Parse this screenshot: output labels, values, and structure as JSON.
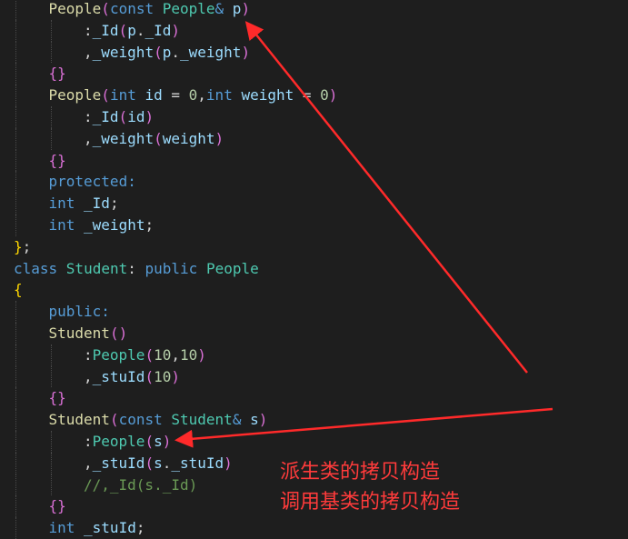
{
  "code_lines": [
    {
      "indent": 1,
      "tokens": [
        {
          "t": "People",
          "c": "fn"
        },
        {
          "t": "(",
          "c": "br1"
        },
        {
          "t": "const ",
          "c": "kw"
        },
        {
          "t": "People",
          "c": "type"
        },
        {
          "t": "& ",
          "c": "kw"
        },
        {
          "t": "p",
          "c": "var"
        },
        {
          "t": ")",
          "c": "br1"
        }
      ]
    },
    {
      "indent": 2,
      "tokens": [
        {
          "t": ":",
          "c": "pl"
        },
        {
          "t": "_Id",
          "c": "var"
        },
        {
          "t": "(",
          "c": "br1"
        },
        {
          "t": "p",
          "c": "var"
        },
        {
          "t": ".",
          "c": "pl"
        },
        {
          "t": "_Id",
          "c": "var"
        },
        {
          "t": ")",
          "c": "br1"
        }
      ]
    },
    {
      "indent": 2,
      "tokens": [
        {
          "t": ",",
          "c": "pl"
        },
        {
          "t": "_weight",
          "c": "var"
        },
        {
          "t": "(",
          "c": "br1"
        },
        {
          "t": "p",
          "c": "var"
        },
        {
          "t": ".",
          "c": "pl"
        },
        {
          "t": "_weight",
          "c": "var"
        },
        {
          "t": ")",
          "c": "br1"
        }
      ]
    },
    {
      "indent": 1,
      "tokens": [
        {
          "t": "{}",
          "c": "br1"
        }
      ]
    },
    {
      "indent": 1,
      "tokens": [
        {
          "t": "People",
          "c": "fn"
        },
        {
          "t": "(",
          "c": "br1"
        },
        {
          "t": "int ",
          "c": "kw"
        },
        {
          "t": "id",
          "c": "var"
        },
        {
          "t": " = ",
          "c": "pl"
        },
        {
          "t": "0",
          "c": "num"
        },
        {
          "t": ",",
          "c": "pl"
        },
        {
          "t": "int ",
          "c": "kw"
        },
        {
          "t": "weight",
          "c": "var"
        },
        {
          "t": " = ",
          "c": "pl"
        },
        {
          "t": "0",
          "c": "num"
        },
        {
          "t": ")",
          "c": "br1"
        }
      ]
    },
    {
      "indent": 2,
      "tokens": [
        {
          "t": ":",
          "c": "pl"
        },
        {
          "t": "_Id",
          "c": "var"
        },
        {
          "t": "(",
          "c": "br1"
        },
        {
          "t": "id",
          "c": "var"
        },
        {
          "t": ")",
          "c": "br1"
        }
      ]
    },
    {
      "indent": 2,
      "tokens": [
        {
          "t": ",",
          "c": "pl"
        },
        {
          "t": "_weight",
          "c": "var"
        },
        {
          "t": "(",
          "c": "br1"
        },
        {
          "t": "weight",
          "c": "var"
        },
        {
          "t": ")",
          "c": "br1"
        }
      ]
    },
    {
      "indent": 1,
      "tokens": [
        {
          "t": "{}",
          "c": "br1"
        }
      ]
    },
    {
      "indent": 1,
      "tokens": [
        {
          "t": "protected:",
          "c": "kw"
        }
      ]
    },
    {
      "indent": 1,
      "tokens": [
        {
          "t": "int ",
          "c": "kw"
        },
        {
          "t": "_Id",
          "c": "var"
        },
        {
          "t": ";",
          "c": "pl"
        }
      ]
    },
    {
      "indent": 1,
      "tokens": [
        {
          "t": "int ",
          "c": "kw"
        },
        {
          "t": "_weight",
          "c": "var"
        },
        {
          "t": ";",
          "c": "pl"
        }
      ]
    },
    {
      "indent": 0,
      "tokens": [
        {
          "t": "}",
          "c": "br2"
        },
        {
          "t": ";",
          "c": "pl"
        }
      ]
    },
    {
      "indent": 0,
      "tokens": [
        {
          "t": "class ",
          "c": "kw"
        },
        {
          "t": "Student",
          "c": "type"
        },
        {
          "t": ": ",
          "c": "pl"
        },
        {
          "t": "public ",
          "c": "kw"
        },
        {
          "t": "People",
          "c": "type"
        }
      ]
    },
    {
      "indent": 0,
      "tokens": [
        {
          "t": "{",
          "c": "br2"
        }
      ]
    },
    {
      "indent": 1,
      "tokens": [
        {
          "t": "public:",
          "c": "kw"
        }
      ]
    },
    {
      "indent": 1,
      "tokens": [
        {
          "t": "Student",
          "c": "fn"
        },
        {
          "t": "()",
          "c": "br1"
        }
      ]
    },
    {
      "indent": 2,
      "tokens": [
        {
          "t": ":",
          "c": "pl"
        },
        {
          "t": "People",
          "c": "type"
        },
        {
          "t": "(",
          "c": "br1"
        },
        {
          "t": "10",
          "c": "num"
        },
        {
          "t": ",",
          "c": "pl"
        },
        {
          "t": "10",
          "c": "num"
        },
        {
          "t": ")",
          "c": "br1"
        }
      ]
    },
    {
      "indent": 2,
      "tokens": [
        {
          "t": ",",
          "c": "pl"
        },
        {
          "t": "_stuId",
          "c": "var"
        },
        {
          "t": "(",
          "c": "br1"
        },
        {
          "t": "10",
          "c": "num"
        },
        {
          "t": ")",
          "c": "br1"
        }
      ]
    },
    {
      "indent": 1,
      "tokens": [
        {
          "t": "{}",
          "c": "br1"
        }
      ]
    },
    {
      "indent": 1,
      "tokens": [
        {
          "t": "Student",
          "c": "fn"
        },
        {
          "t": "(",
          "c": "br1"
        },
        {
          "t": "const ",
          "c": "kw"
        },
        {
          "t": "Student",
          "c": "type"
        },
        {
          "t": "& ",
          "c": "kw"
        },
        {
          "t": "s",
          "c": "var"
        },
        {
          "t": ")",
          "c": "br1"
        }
      ]
    },
    {
      "indent": 2,
      "tokens": [
        {
          "t": ":",
          "c": "pl"
        },
        {
          "t": "People",
          "c": "type"
        },
        {
          "t": "(",
          "c": "br1"
        },
        {
          "t": "s",
          "c": "var"
        },
        {
          "t": ")",
          "c": "br1"
        }
      ]
    },
    {
      "indent": 2,
      "tokens": [
        {
          "t": ",",
          "c": "pl"
        },
        {
          "t": "_stuId",
          "c": "var"
        },
        {
          "t": "(",
          "c": "br1"
        },
        {
          "t": "s",
          "c": "var"
        },
        {
          "t": ".",
          "c": "pl"
        },
        {
          "t": "_stuId",
          "c": "var"
        },
        {
          "t": ")",
          "c": "br1"
        }
      ]
    },
    {
      "indent": 2,
      "tokens": [
        {
          "t": "//,_Id(s._Id)",
          "c": "cm"
        }
      ]
    },
    {
      "indent": 1,
      "tokens": [
        {
          "t": "{}",
          "c": "br1"
        }
      ]
    },
    {
      "indent": 1,
      "tokens": [
        {
          "t": "int ",
          "c": "kw"
        },
        {
          "t": "_stuId",
          "c": "var"
        },
        {
          "t": ";",
          "c": "pl"
        }
      ]
    }
  ],
  "annotation": {
    "line1": "派生类的拷贝构造",
    "line2": "调用基类的拷贝构造",
    "color": "#ff3b3b"
  },
  "theme": {
    "background": "#1e1e1e",
    "type": "#4ec9b0",
    "keyword": "#569cd6",
    "variable": "#9cdcfe",
    "function": "#dcdcaa",
    "number": "#b5cea8",
    "comment": "#6a9955",
    "bracket_1": "#da70d6",
    "bracket_2": "#ffd700"
  }
}
